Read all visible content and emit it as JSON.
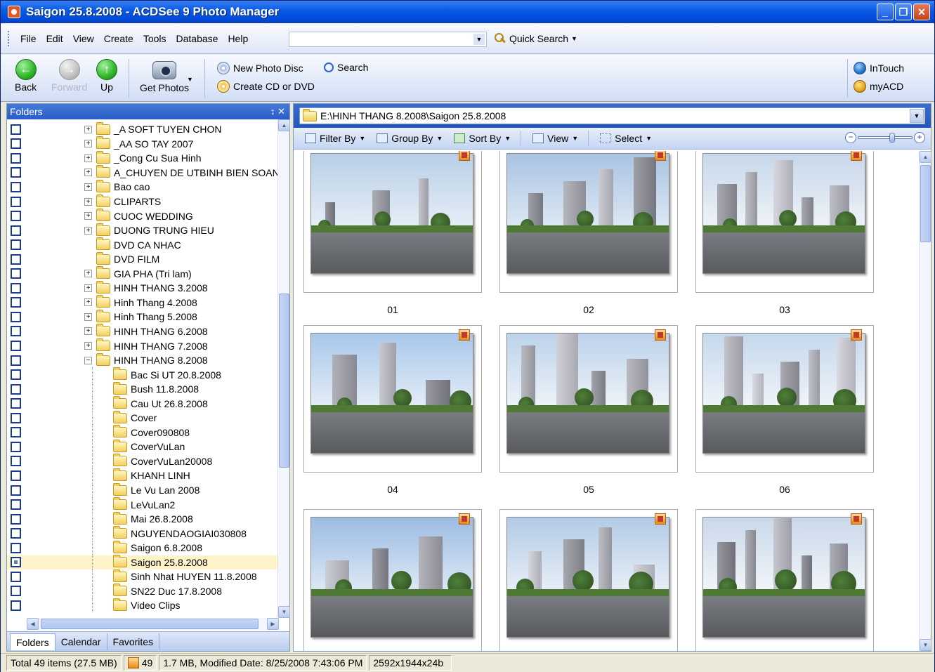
{
  "window": {
    "title": "Saigon 25.8.2008 - ACDSee 9 Photo Manager",
    "controls": [
      "_",
      "❐",
      "✕"
    ]
  },
  "menu": {
    "items": [
      "File",
      "Edit",
      "View",
      "Create",
      "Tools",
      "Database",
      "Help"
    ],
    "quick_search_label": "Quick Search",
    "search_value": ""
  },
  "toolbar": {
    "back": "Back",
    "forward": "Forward",
    "up": "Up",
    "get_photos": "Get Photos",
    "new_photo_disc": "New Photo Disc",
    "create_cd": "Create CD or DVD",
    "search": "Search",
    "intouch": "InTouch",
    "myacd": "myACD"
  },
  "folders_panel": {
    "title": "Folders",
    "controls": "↕ ✕",
    "items": [
      {
        "label": "_A SOFT TUYEN CHON",
        "level": 1,
        "expander": "+"
      },
      {
        "label": "_AA SO TAY 2007",
        "level": 1,
        "expander": "+"
      },
      {
        "label": "_Cong Cu Sua Hinh",
        "level": 1,
        "expander": "+"
      },
      {
        "label": "A_CHUYEN DE UTBINH BIEN SOAN",
        "level": 1,
        "expander": "+"
      },
      {
        "label": "Bao cao",
        "level": 1,
        "expander": "+"
      },
      {
        "label": "CLIPARTS",
        "level": 1,
        "expander": "+"
      },
      {
        "label": "CUOC WEDDING",
        "level": 1,
        "expander": "+"
      },
      {
        "label": "DUONG TRUNG HIEU",
        "level": 1,
        "expander": "+"
      },
      {
        "label": "DVD CA NHAC",
        "level": 1,
        "expander": ""
      },
      {
        "label": "DVD FILM",
        "level": 1,
        "expander": ""
      },
      {
        "label": "GIA PHA (Tri lam)",
        "level": 1,
        "expander": "+"
      },
      {
        "label": "HINH THANG 3.2008",
        "level": 1,
        "expander": "+"
      },
      {
        "label": "Hinh Thang 4.2008",
        "level": 1,
        "expander": "+"
      },
      {
        "label": "Hinh Thang 5.2008",
        "level": 1,
        "expander": "+"
      },
      {
        "label": "HINH THANG 6.2008",
        "level": 1,
        "expander": "+"
      },
      {
        "label": "HINH THANG 7.2008",
        "level": 1,
        "expander": "+"
      },
      {
        "label": "HINH THANG 8.2008",
        "level": 1,
        "expander": "−"
      },
      {
        "label": "Bac Si UT 20.8.2008",
        "level": 2,
        "expander": ""
      },
      {
        "label": "Bush 11.8.2008",
        "level": 2,
        "expander": ""
      },
      {
        "label": "Cau Ut 26.8.2008",
        "level": 2,
        "expander": ""
      },
      {
        "label": "Cover",
        "level": 2,
        "expander": ""
      },
      {
        "label": "Cover090808",
        "level": 2,
        "expander": ""
      },
      {
        "label": "CoverVuLan",
        "level": 2,
        "expander": ""
      },
      {
        "label": "CoverVuLan20008",
        "level": 2,
        "expander": ""
      },
      {
        "label": "KHANH LINH",
        "level": 2,
        "expander": ""
      },
      {
        "label": "Le Vu Lan 2008",
        "level": 2,
        "expander": ""
      },
      {
        "label": "LeVuLan2",
        "level": 2,
        "expander": ""
      },
      {
        "label": "Mai 26.8.2008",
        "level": 2,
        "expander": ""
      },
      {
        "label": "NGUYENDAOGIAI030808",
        "level": 2,
        "expander": ""
      },
      {
        "label": "Saigon 6.8.2008",
        "level": 2,
        "expander": ""
      },
      {
        "label": "Saigon 25.8.2008",
        "level": 2,
        "expander": "",
        "selected": true
      },
      {
        "label": "Sinh Nhat HUYEN 11.8.2008",
        "level": 2,
        "expander": ""
      },
      {
        "label": "SN22 Duc 17.8.2008",
        "level": 2,
        "expander": ""
      },
      {
        "label": "Video Clips",
        "level": 2,
        "expander": ""
      }
    ],
    "tabs": [
      "Folders",
      "Calendar",
      "Favorites"
    ]
  },
  "browser": {
    "path": "E:\\HINH THANG 8.2008\\Saigon 25.8.2008",
    "filter_by": "Filter By",
    "group_by": "Group By",
    "sort_by": "Sort By",
    "view": "View",
    "select": "Select",
    "thumbnails": [
      "01",
      "02",
      "03",
      "04",
      "05",
      "06",
      "",
      "",
      ""
    ]
  },
  "status": {
    "total": "Total 49 items  (27.5 MB)",
    "count": "49",
    "file_info": "1.7 MB, Modified Date: 8/25/2008 7:43:06 PM",
    "dimensions": "2592x1944x24b"
  },
  "colors": {
    "titlebar": "#0a5ce6",
    "selection": "#fff4c9",
    "panel_header": "#2a5ec8"
  }
}
